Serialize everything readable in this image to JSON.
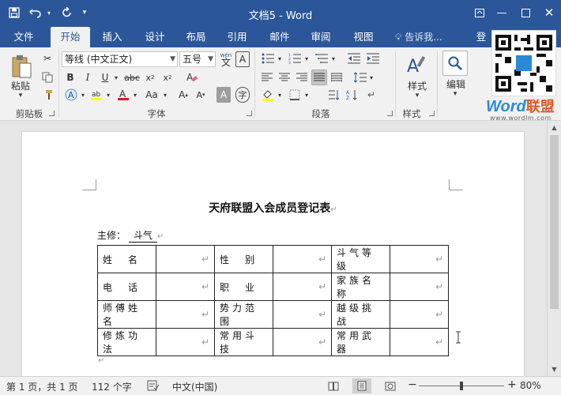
{
  "titlebar": {
    "title": "文档5 - Word",
    "save_icon": "save-icon",
    "undo_icon": "undo-icon",
    "redo_icon": "redo-icon"
  },
  "tabs": [
    {
      "label": "文件"
    },
    {
      "label": "开始"
    },
    {
      "label": "插入"
    },
    {
      "label": "设计"
    },
    {
      "label": "布局"
    },
    {
      "label": "引用"
    },
    {
      "label": "邮件"
    },
    {
      "label": "审阅"
    },
    {
      "label": "视图"
    }
  ],
  "active_tab": "开始",
  "tell_me": "告诉我...",
  "account_partial": "登",
  "ribbon": {
    "clipboard": {
      "label": "剪贴板",
      "paste": "粘贴"
    },
    "font": {
      "label": "字体",
      "font_name": "等线 (中文正文)",
      "font_size": "五号",
      "phonetic": "wén"
    },
    "paragraph": {
      "label": "段落"
    },
    "styles": {
      "label": "样式",
      "button": "样式"
    },
    "editing": {
      "label": "",
      "button": "编辑"
    }
  },
  "watermark": {
    "logo_en": "Word",
    "logo_cn": "联盟",
    "url": "www.wordlm.com"
  },
  "document": {
    "heading": "天府联盟入会成员登记表",
    "editor_label": "主修：",
    "editor_value": "斗气",
    "table": [
      [
        "姓　名",
        "性　别",
        "斗气等级"
      ],
      [
        "电　话",
        "职　业",
        "家族名称"
      ],
      [
        "师傅姓名",
        "势力范围",
        "越级挑战"
      ],
      [
        "修炼功法",
        "常用斗技",
        "常用武器"
      ]
    ]
  },
  "status": {
    "page": "第 1 页，共 1 页",
    "words": "112 个字",
    "language": "中文(中国)",
    "zoom": "80%",
    "zoom_minus": "−",
    "zoom_plus": "+",
    "zoom_fraction": 0.5
  },
  "colors": {
    "accent": "#2b579a",
    "ribbon": "#f1f1f1",
    "highlight": "#ffff00",
    "font_color": "#e81123"
  }
}
